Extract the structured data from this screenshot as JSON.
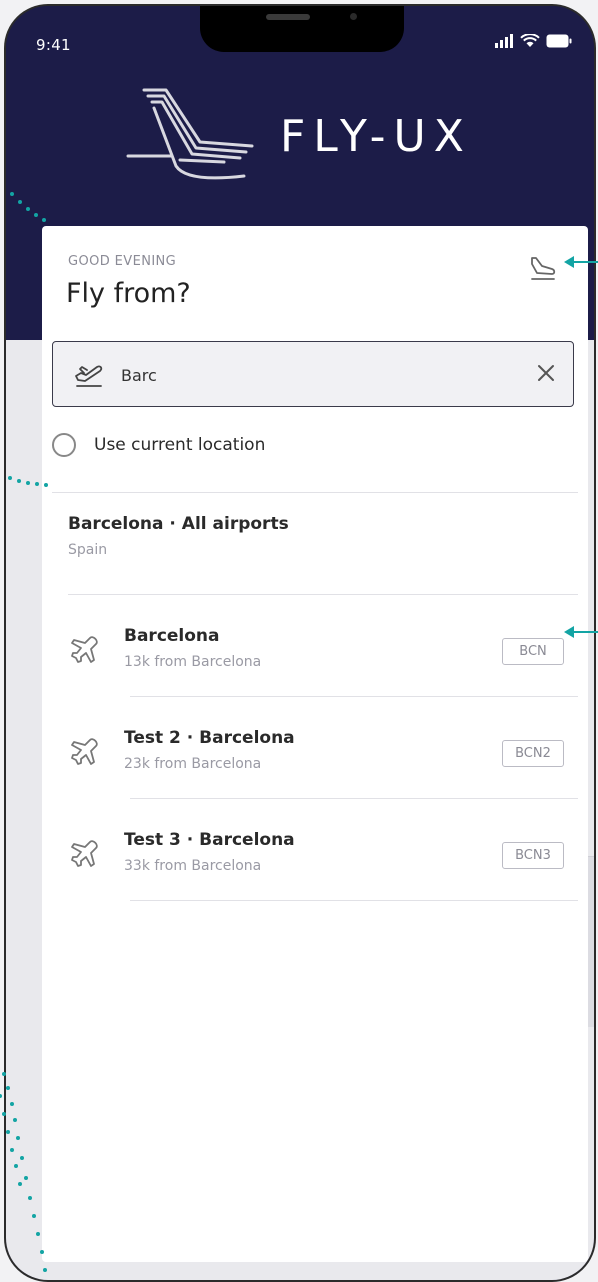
{
  "status": {
    "time": "9:41"
  },
  "brand": {
    "name": "FLY-UX"
  },
  "card": {
    "greeting": "GOOD EVENING",
    "title": "Fly from?"
  },
  "search": {
    "value": "Barc"
  },
  "location": {
    "label": "Use current location"
  },
  "group": {
    "name": "Barcelona · All airports",
    "country": "Spain"
  },
  "airports": [
    {
      "name": "Barcelona",
      "distance": "13k from Barcelona",
      "code": "BCN"
    },
    {
      "name": "Test 2 · Barcelona",
      "distance": "23k from Barcelona",
      "code": "BCN2"
    },
    {
      "name": "Test 3 · Barcelona",
      "distance": "33k from Barcelona",
      "code": "BCN3"
    }
  ],
  "colors": {
    "header": "#1c1c48",
    "annotation": "#13a4a4",
    "text": "#2a2a2a",
    "muted": "#9a9aa4"
  },
  "icons": [
    "plane-takeoff-icon",
    "plane-landing-icon",
    "close-icon",
    "airplane-icon",
    "signal-icon",
    "wifi-icon",
    "battery-icon"
  ]
}
